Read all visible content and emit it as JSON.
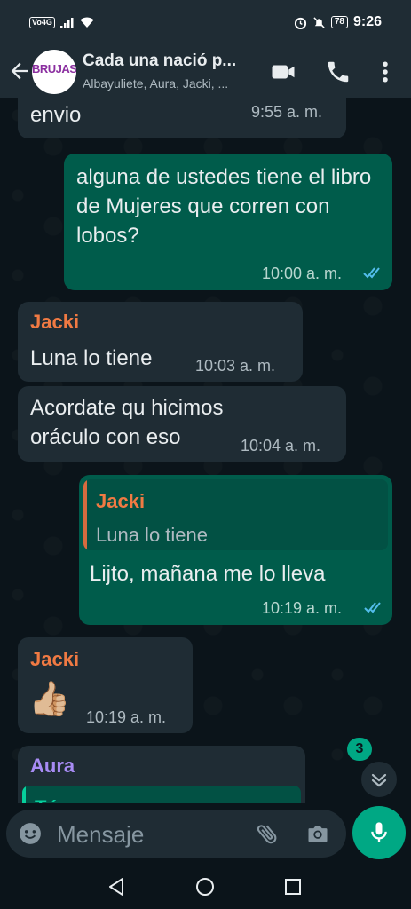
{
  "status_bar": {
    "carrier_badge": "Vo4G",
    "time": "9:26",
    "battery": "78"
  },
  "header": {
    "avatar_text": "BRUJAS",
    "title": "Cada una nació p...",
    "subtitle": "Albayuliete, Aura, Jacki, ..."
  },
  "messages": {
    "m1": {
      "text": "envio",
      "time": "9:55 a. m."
    },
    "m2": {
      "text": "alguna de ustedes tiene el libro de Mujeres que corren con lobos?",
      "time": "10:00 a. m."
    },
    "m3": {
      "sender": "Jacki",
      "text": "Luna lo tiene",
      "time": "10:03 a. m."
    },
    "m4": {
      "text": "Acordate qu hicimos oráculo con eso",
      "time": "10:04 a. m."
    },
    "m5": {
      "quote_sender": "Jacki",
      "quote_text": "Luna lo tiene",
      "text": "Lijto, mañana me lo lleva",
      "time": "10:19 a. m."
    },
    "m6": {
      "sender": "Jacki",
      "emoji": "👍🏼",
      "time": "10:19 a. m."
    },
    "m7": {
      "sender": "Aura",
      "quote_partial": "Tú"
    }
  },
  "unread_count": "3",
  "composer": {
    "placeholder": "Mensaje"
  },
  "colors": {
    "sender_jacki": "#f07a43",
    "sender_aura": "#a88cf5",
    "accent": "#00a884",
    "read_ticks": "#53bdeb"
  },
  "icons": [
    "back-arrow-icon",
    "video-call-icon",
    "voice-call-icon",
    "more-vert-icon",
    "chevron-down-icon",
    "emoji-icon",
    "attach-icon",
    "camera-icon",
    "mic-icon",
    "nav-back-icon",
    "nav-home-icon",
    "nav-recents-icon"
  ]
}
